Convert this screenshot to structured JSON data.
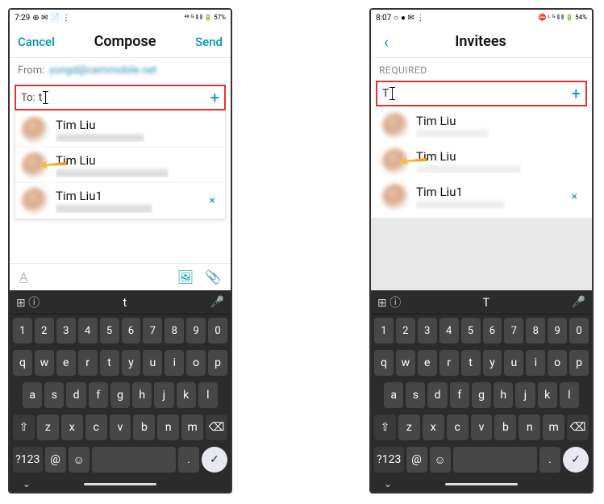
{
  "left": {
    "status": {
      "time": "7:29",
      "icons": "⊕ ✉ 📄 ⋮",
      "right": "⁴⁶ ᴳ ⫴ ⫴ 🔋 57%"
    },
    "nav": {
      "cancel": "Cancel",
      "title": "Compose",
      "send": "Send"
    },
    "from": {
      "label": "From:",
      "value": "yongd@cemmobile.net"
    },
    "to": {
      "label": "To:",
      "typed": "t",
      "plus": "+"
    },
    "suggestions": [
      {
        "name": "Tim Liu"
      },
      {
        "name": "Tim Liu"
      },
      {
        "name": "Tim Liu1",
        "removable": true
      }
    ],
    "toolbar": {
      "a": "A",
      "image": "🖼",
      "attach": "📎"
    },
    "keyboard": {
      "suggest_glyph": "⊞ ⓘ",
      "suggest_mid": "t",
      "suggest_mic": "🎤",
      "row_num": [
        "1",
        "2",
        "3",
        "4",
        "5",
        "6",
        "7",
        "8",
        "9",
        "0"
      ],
      "row1": [
        "q",
        "w",
        "e",
        "r",
        "t",
        "y",
        "u",
        "i",
        "o",
        "p"
      ],
      "row2": [
        "a",
        "s",
        "d",
        "f",
        "g",
        "h",
        "j",
        "k",
        "l"
      ],
      "row3_shift": "⇧",
      "row3": [
        "z",
        "x",
        "c",
        "v",
        "b",
        "n",
        "m"
      ],
      "row3_del": "⌫",
      "row4": {
        "num": "?123",
        "at": "@",
        "emoji": "☺",
        "space": " ",
        "dot": ".",
        "submit": "✓"
      }
    }
  },
  "right": {
    "status": {
      "time": "8:07",
      "icons": "○ ● ✉ ⋮",
      "right": "⛔ ᴸ ᴳ ⫴ ⫴ 🔋 54%"
    },
    "nav": {
      "back": "‹",
      "title": "Invitees"
    },
    "required_label": "REQUIRED",
    "to": {
      "typed": "T",
      "plus": "+"
    },
    "suggestions": [
      {
        "name": "Tim Liu"
      },
      {
        "name": "Tim Liu"
      },
      {
        "name": "Tim Liu1",
        "removable": true
      }
    ],
    "keyboard": {
      "suggest_glyph": "⊞ ⓘ",
      "suggest_mid": "T",
      "suggest_mic": "🎤",
      "row_num": [
        "1",
        "2",
        "3",
        "4",
        "5",
        "6",
        "7",
        "8",
        "9",
        "0"
      ],
      "row1": [
        "q",
        "w",
        "e",
        "r",
        "t",
        "y",
        "u",
        "i",
        "o",
        "p"
      ],
      "row2": [
        "a",
        "s",
        "d",
        "f",
        "g",
        "h",
        "j",
        "k",
        "l"
      ],
      "row3_shift": "⇧",
      "row3": [
        "z",
        "x",
        "c",
        "v",
        "b",
        "n",
        "m"
      ],
      "row3_del": "⌫",
      "row4": {
        "num": "?123",
        "at": "@",
        "emoji": "☺",
        "space": " ",
        "dot": ".",
        "submit": "✓"
      }
    }
  }
}
